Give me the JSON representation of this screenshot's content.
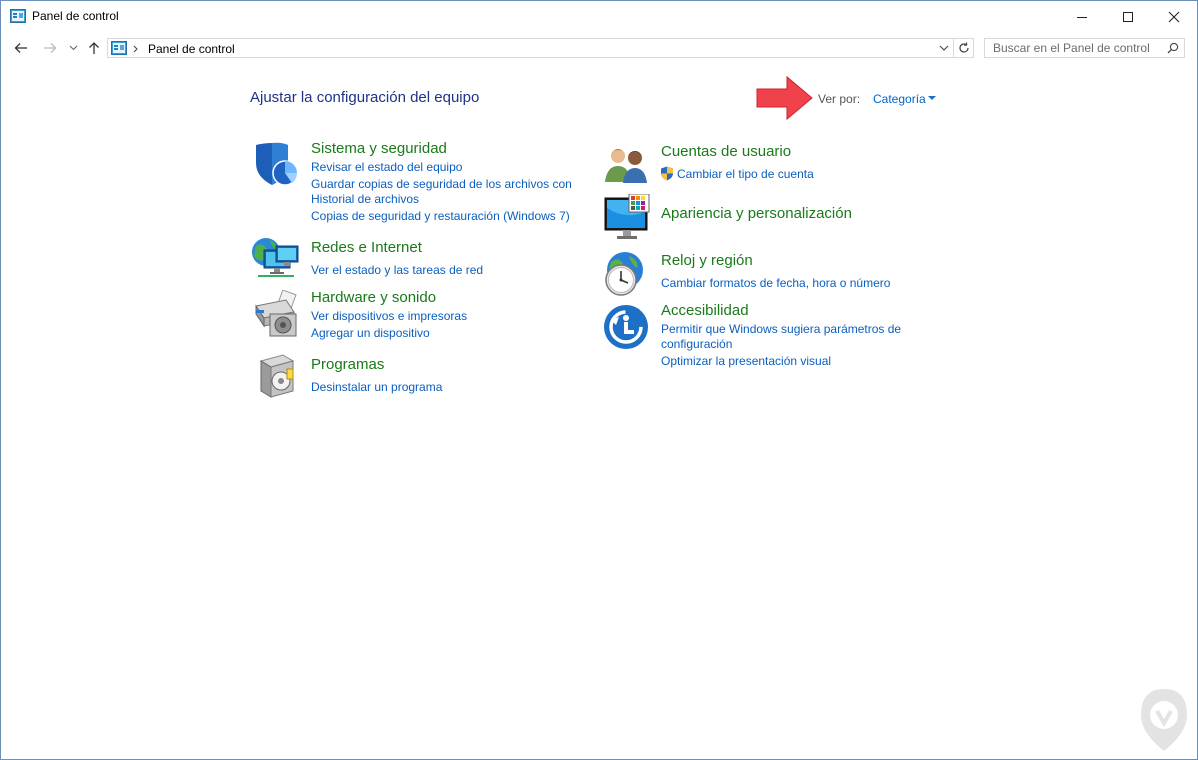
{
  "window": {
    "title": "Panel de control"
  },
  "address": {
    "breadcrumb": "Panel de control",
    "search_placeholder": "Buscar en el Panel de control"
  },
  "main": {
    "heading": "Ajustar la configuración del equipo",
    "view_by_label": "Ver por:",
    "view_by_value": "Categoría"
  },
  "categories": [
    {
      "title": "Sistema y seguridad",
      "icon": "shield-icon",
      "links": [
        "Revisar el estado del equipo",
        "Guardar copias de seguridad de los archivos con",
        "Historial de archivos",
        "Copias de seguridad y restauración (Windows 7)"
      ]
    },
    {
      "title": "Redes e Internet",
      "icon": "network-icon",
      "links": [
        "Ver el estado y las tareas de red"
      ]
    },
    {
      "title": "Hardware y sonido",
      "icon": "printer-icon",
      "links": [
        "Ver dispositivos e impresoras",
        "Agregar un dispositivo"
      ]
    },
    {
      "title": "Programas",
      "icon": "programs-icon",
      "links": [
        "Desinstalar un programa"
      ]
    },
    {
      "title": "Cuentas de usuario",
      "icon": "users-icon",
      "links": [
        "Cambiar el tipo de cuenta"
      ]
    },
    {
      "title": "Apariencia y personalización",
      "icon": "monitor-icon",
      "links": []
    },
    {
      "title": "Reloj y región",
      "icon": "clock-icon",
      "links": [
        "Cambiar formatos de fecha, hora o número"
      ]
    },
    {
      "title": "Accesibilidad",
      "icon": "accessibility-icon",
      "links": [
        "Permitir que Windows sugiera parámetros de",
        "configuración",
        "Optimizar la presentación visual"
      ]
    }
  ],
  "colors": {
    "category_title": "#1a7a1a",
    "link": "#0b5fbf",
    "heading": "#1e3287",
    "annotation_arrow": "#f0424b"
  }
}
